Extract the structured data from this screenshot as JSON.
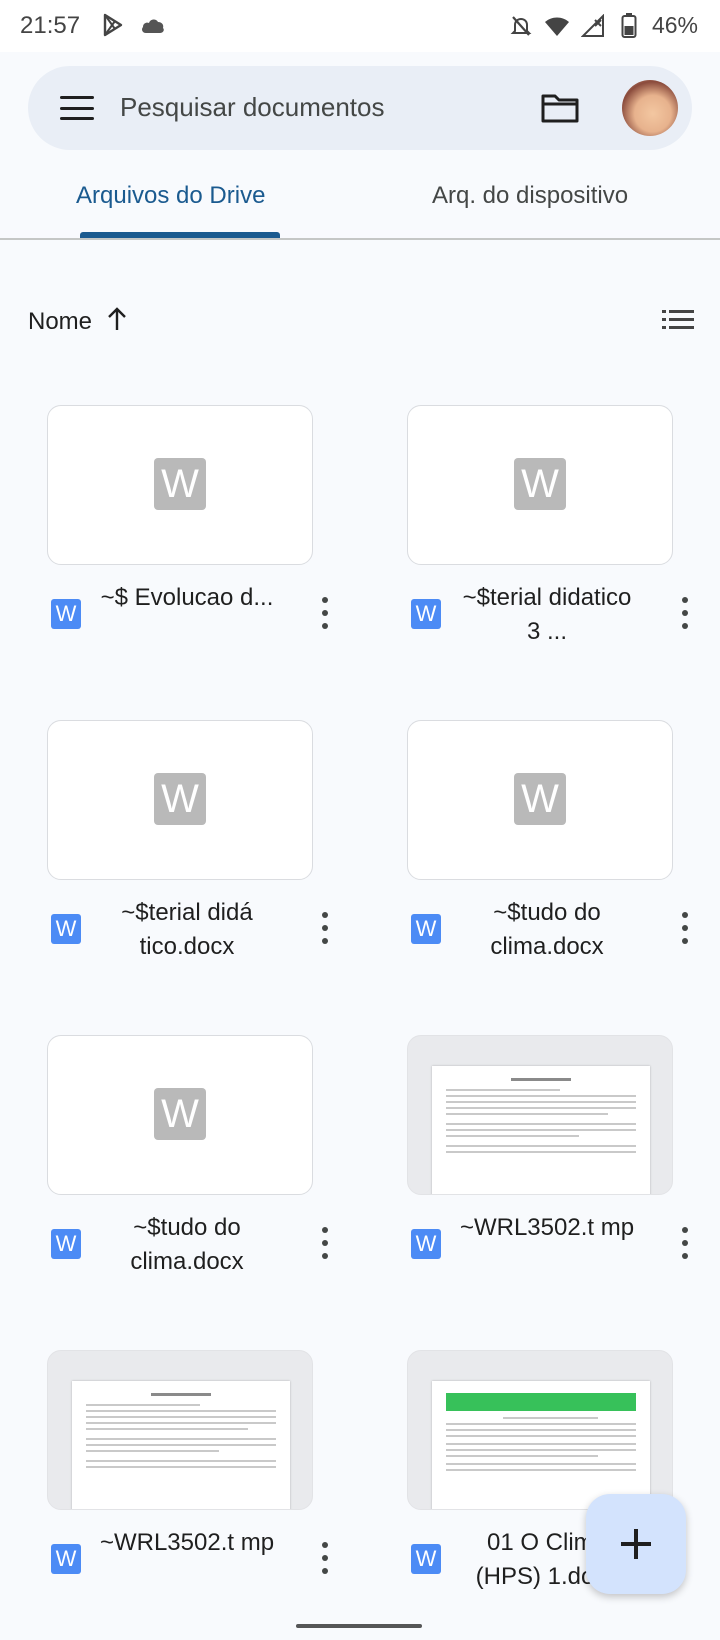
{
  "status_bar": {
    "time": "21:57",
    "battery": "46%",
    "icons": [
      "play-store-icon",
      "cloud-icon",
      "mute-icon",
      "wifi-icon",
      "signal-icon",
      "battery-icon"
    ]
  },
  "search": {
    "placeholder": "Pesquisar documentos"
  },
  "tabs": [
    {
      "label": "Arquivos do Drive",
      "selected": true
    },
    {
      "label": "Arq. do dispositivo",
      "selected": false
    }
  ],
  "sort": {
    "label": "Nome",
    "direction": "ascending"
  },
  "files": [
    {
      "name": "~$ Evolucao d...",
      "thumbnail": "placeholder"
    },
    {
      "name": "~$terial didatico 3 ...",
      "thumbnail": "placeholder"
    },
    {
      "name": "~$terial didá tico.docx",
      "thumbnail": "placeholder"
    },
    {
      "name": "~$tudo do clima.docx",
      "thumbnail": "placeholder"
    },
    {
      "name": "~$tudo do clima.docx",
      "thumbnail": "placeholder"
    },
    {
      "name": "~WRL3502.t mp",
      "thumbnail": "document"
    },
    {
      "name": "~WRL3502.t mp",
      "thumbnail": "document"
    },
    {
      "name": "01 O Clima (HPS) 1.docx",
      "thumbnail": "document-green"
    }
  ],
  "thumbnail_letter": "W",
  "colors": {
    "accent": "#1a5a8f",
    "word_icon": "#4c8bf5",
    "fab": "#d3e3fd"
  }
}
